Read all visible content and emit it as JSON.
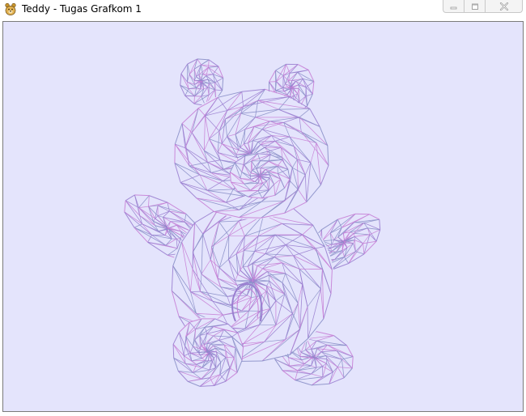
{
  "window": {
    "title": "Teddy - Tugas Grafkom 1",
    "icon": "teddy-app-icon",
    "controls": {
      "minimize_icon": "minimize-icon",
      "maximize_icon": "maximize-icon",
      "close_icon": "close-icon"
    }
  },
  "viewport": {
    "background": "#e4e4fc",
    "model": "teddy-bear-wireframe",
    "render_mode": "wireframe",
    "colors": {
      "edge_primary": "#9a7fd0",
      "edge_secondary": "#c77fd6",
      "edge_tertiary": "#8a8fc8"
    }
  }
}
